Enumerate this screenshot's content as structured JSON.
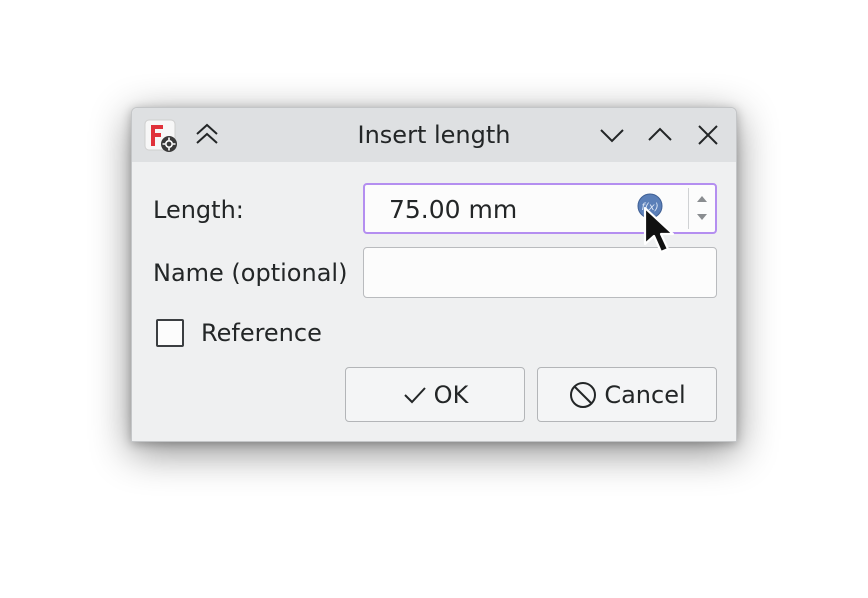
{
  "window": {
    "title": "Insert length"
  },
  "titlebar": {
    "app_icon": "freecad-sketcher-icon",
    "shade_icon": "double-chevron-up-icon",
    "minimize_icon": "chevron-down-icon",
    "maximize_icon": "chevron-up-icon",
    "close_icon": "close-icon"
  },
  "form": {
    "length_label": "Length:",
    "length_value": "75.00 mm",
    "name_label": "Name (optional)",
    "name_value": "",
    "reference_label": "Reference",
    "reference_checked": false
  },
  "buttons": {
    "ok_label": "OK",
    "cancel_label": "Cancel"
  },
  "colors": {
    "focus_border": "#b48ef0",
    "expression_icon": "#5b7fb8"
  }
}
